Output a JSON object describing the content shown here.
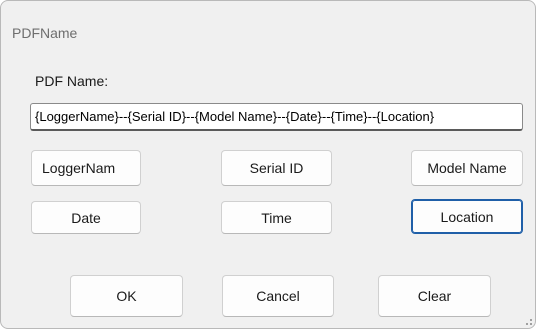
{
  "window": {
    "title": "PDFName"
  },
  "field": {
    "label": "PDF Name:",
    "value": "{LoggerName}--{Serial ID}--{Model Name}--{Date}--{Time}--{Location}"
  },
  "tokens": {
    "logger_name": "LoggerNam",
    "serial_id": "Serial ID",
    "model_name": "Model Name",
    "date": "Date",
    "time": "Time",
    "location": "Location"
  },
  "actions": {
    "ok": "OK",
    "cancel": "Cancel",
    "clear": "Clear"
  },
  "colors": {
    "dialog_bg": "#f0f0f0",
    "focus_border": "#1f5fa8"
  }
}
